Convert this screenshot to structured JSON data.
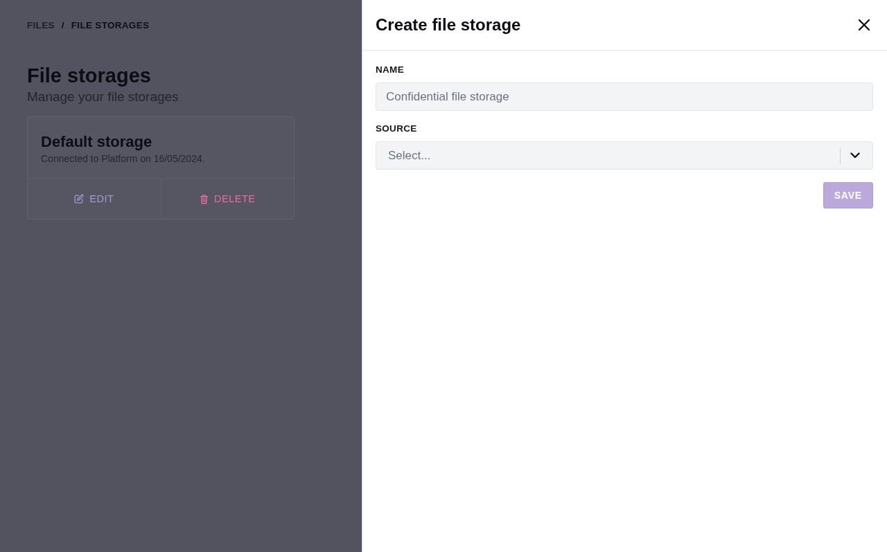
{
  "breadcrumb": {
    "items": [
      {
        "label": "FILES"
      },
      {
        "label": "FILE STORAGES"
      }
    ],
    "separator": "/"
  },
  "page": {
    "title": "File storages",
    "subtitle": "Manage your file storages"
  },
  "storages": [
    {
      "name": "Default storage",
      "description": "Connected to Platform on 16/05/2024.",
      "actions": [
        {
          "kind": "edit",
          "label": "EDIT"
        },
        {
          "kind": "delete",
          "label": "DELETE"
        }
      ]
    }
  ],
  "panel": {
    "title": "Create file storage",
    "fields": [
      {
        "kind": "text",
        "label": "NAME",
        "placeholder": "Confidential file storage"
      },
      {
        "kind": "select",
        "label": "SOURCE",
        "placeholder": "Select..."
      }
    ],
    "save_button": {
      "label": "SAVE",
      "disabled": true
    }
  }
}
